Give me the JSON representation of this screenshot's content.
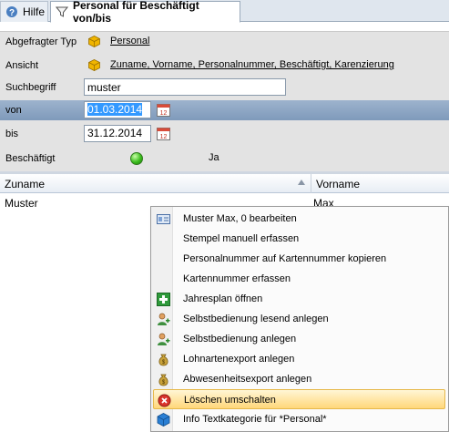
{
  "tabs": [
    {
      "label": "Hilfe",
      "icon": "help-icon"
    },
    {
      "label": "Personal für Beschäftigt von/bis",
      "icon": "filter-funnel-icon",
      "active": true
    }
  ],
  "filter": {
    "typ_label": "Abgefragter Typ",
    "typ_value": "Personal",
    "ansicht_label": "Ansicht",
    "ansicht_value": "Zuname, Vorname, Personalnummer, Beschäftigt, Karenzierung",
    "such_label": "Suchbegriff",
    "such_value": "muster",
    "von_label": "von",
    "von_value": "01.03.2014",
    "bis_label": "bis",
    "bis_value": "31.12.2014",
    "besch_label": "Beschäftigt",
    "besch_value": "Ja",
    "besch_status_color": "#3bbd1d"
  },
  "grid": {
    "columns": [
      "Zuname",
      "Vorname"
    ],
    "rows": [
      {
        "zuname": "Muster",
        "vorname": "Max"
      }
    ]
  },
  "context_menu": {
    "items": [
      {
        "label": "Muster Max, 0 bearbeiten",
        "icon": "edit-card-icon"
      },
      {
        "label": "Stempel manuell erfassen",
        "icon": ""
      },
      {
        "label": "Personalnummer auf Kartennummer kopieren",
        "icon": ""
      },
      {
        "label": "Kartennummer erfassen",
        "icon": ""
      },
      {
        "label": "Jahresplan öffnen",
        "icon": "plus-calendar-icon"
      },
      {
        "label": "Selbstbedienung lesend anlegen",
        "icon": "user-add-icon"
      },
      {
        "label": "Selbstbedienung anlegen",
        "icon": "user-add-icon"
      },
      {
        "label": "Lohnartenexport anlegen",
        "icon": "money-bag-icon"
      },
      {
        "label": "Abwesenheitsexport anlegen",
        "icon": "money-bag-icon"
      },
      {
        "label": "Löschen umschalten",
        "icon": "delete-circle-icon",
        "highlighted": true
      },
      {
        "label": "Info Textkategorie für *Personal*",
        "icon": "blue-cube-icon"
      }
    ]
  }
}
